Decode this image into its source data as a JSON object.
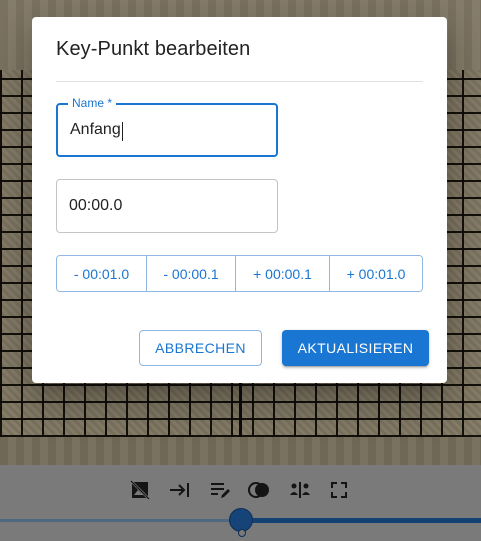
{
  "dialog": {
    "title": "Key-Punkt bearbeiten",
    "name_label": "Name *",
    "name_value": "Anfang",
    "time_value": "00:00.0",
    "steps": [
      "- 00:01.0",
      "- 00:00.1",
      "+ 00:00.1",
      "+ 00:01.0"
    ],
    "cancel_label": "ABBRECHEN",
    "update_label": "AKTUALISIEREN"
  },
  "toolbar": {
    "icons": [
      "image-off-icon",
      "arrow-to-end-icon",
      "edit-list-icon",
      "blend-icon",
      "split-view-icon",
      "fullscreen-icon"
    ]
  },
  "slider": {
    "position": 0.5
  },
  "colors": {
    "accent": "#1976d2",
    "toolbar": "#a9a9a9"
  }
}
